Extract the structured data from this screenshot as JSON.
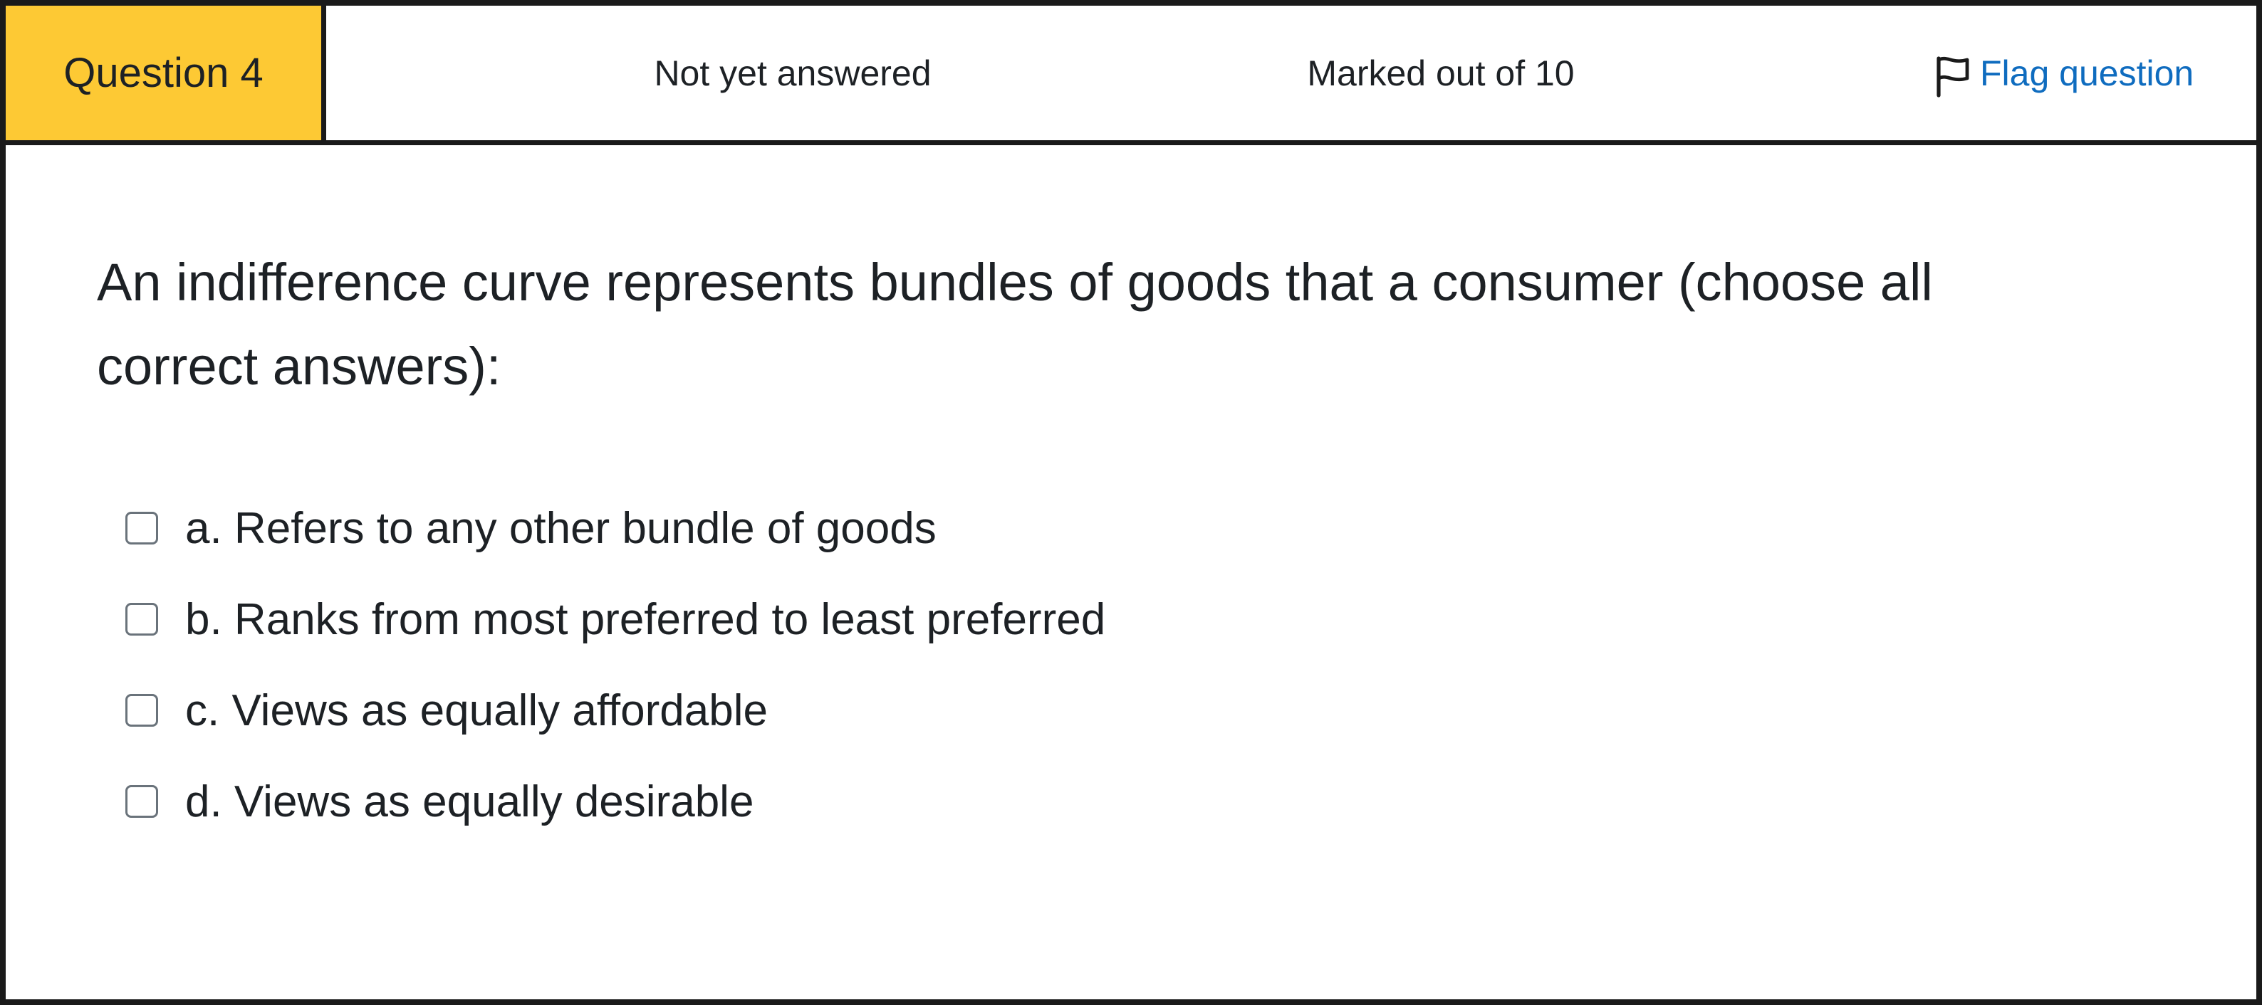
{
  "header": {
    "question_number": "Question 4",
    "state": "Not yet answered",
    "grade": "Marked out of 10",
    "flag_label": "Flag question",
    "flag_icon": "flag-outline-icon"
  },
  "question": {
    "text": "An indifference curve represents bundles of goods that a consumer (choose all correct answers):"
  },
  "answers": [
    {
      "label": "a. Refers to any other bundle of goods",
      "checked": false
    },
    {
      "label": "b. Ranks from most preferred to least preferred",
      "checked": false
    },
    {
      "label": "c. Views as equally affordable",
      "checked": false
    },
    {
      "label": "d. Views as equally desirable",
      "checked": false
    }
  ],
  "colors": {
    "question_badge": "#fdc934",
    "link": "#0f6cbf",
    "border": "#1a1a1a",
    "text": "#1d2125"
  }
}
